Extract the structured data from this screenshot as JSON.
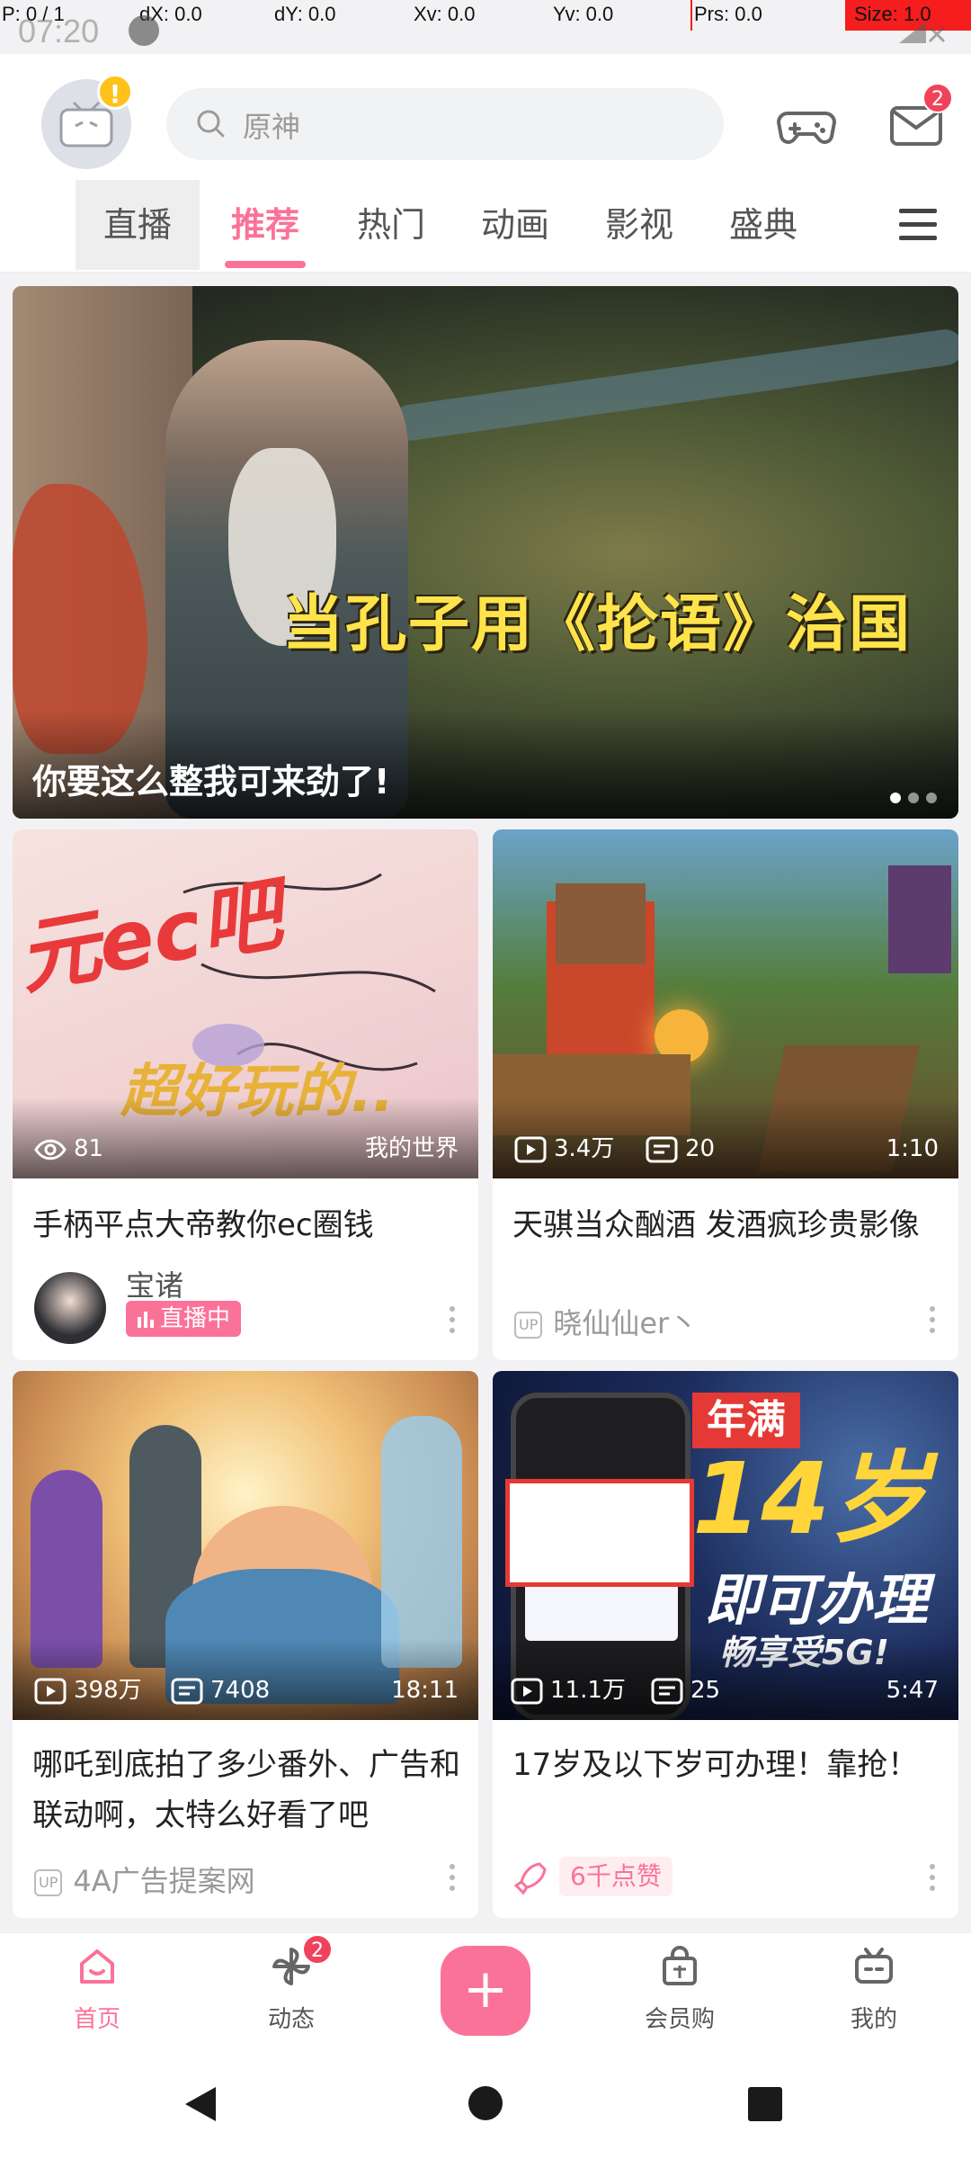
{
  "debug_overlay": {
    "p": "P: 0 / 1",
    "dx": "dX: 0.0",
    "dy": "dY: 0.0",
    "xv": "Xv: 0.0",
    "yv": "Yv: 0.0",
    "prs": "Prs: 0.0",
    "size": "Size: 1.0"
  },
  "status_bar": {
    "time": "07:20"
  },
  "header": {
    "search_placeholder": "原神",
    "avatar_alert": "!",
    "mail_badge": "2"
  },
  "tabs": [
    {
      "label": "直播"
    },
    {
      "label": "推荐"
    },
    {
      "label": "热门"
    },
    {
      "label": "动画"
    },
    {
      "label": "影视"
    },
    {
      "label": "盛典"
    }
  ],
  "banner": {
    "title_overlay": "当孔子用《抡语》治国",
    "caption": "你要这么整我可来劲了!"
  },
  "cards": [
    {
      "views": "81",
      "tag": "我的世界",
      "title": "手柄平点大帝教你ec圈钱",
      "up_name": "宝诸",
      "live_label": "直播中",
      "thumb_text": "元ec吧",
      "thumb_text2": "超好玩的.."
    },
    {
      "views": "3.4万",
      "comments": "20",
      "duration": "1:10",
      "title": "天骐当众酗酒 发酒疯珍贵影像",
      "up_name": "晓仙仙er丶",
      "up_tag": "UP"
    },
    {
      "views": "398万",
      "comments": "7408",
      "duration": "18:11",
      "title": "哪吒到底拍了多少番外、广告和联动啊，太特么好看了吧",
      "up_name": "4A广告提案网",
      "up_tag": "UP"
    },
    {
      "views": "11.1万",
      "comments": "25",
      "duration": "5:47",
      "title": "17岁及以下岁可办理！靠抢！",
      "likes": "6千点赞",
      "ad_line1": "年满",
      "ad_line2": "14岁",
      "ad_line3": "即可办理",
      "ad_line4": "畅享受5G!"
    }
  ],
  "bottom_nav": [
    {
      "label": "首页"
    },
    {
      "label": "动态",
      "badge": "2"
    },
    {
      "label": "+"
    },
    {
      "label": "会员购"
    },
    {
      "label": "我的"
    }
  ],
  "colors": {
    "accent": "#fb7299",
    "badge": "#f0435b"
  }
}
